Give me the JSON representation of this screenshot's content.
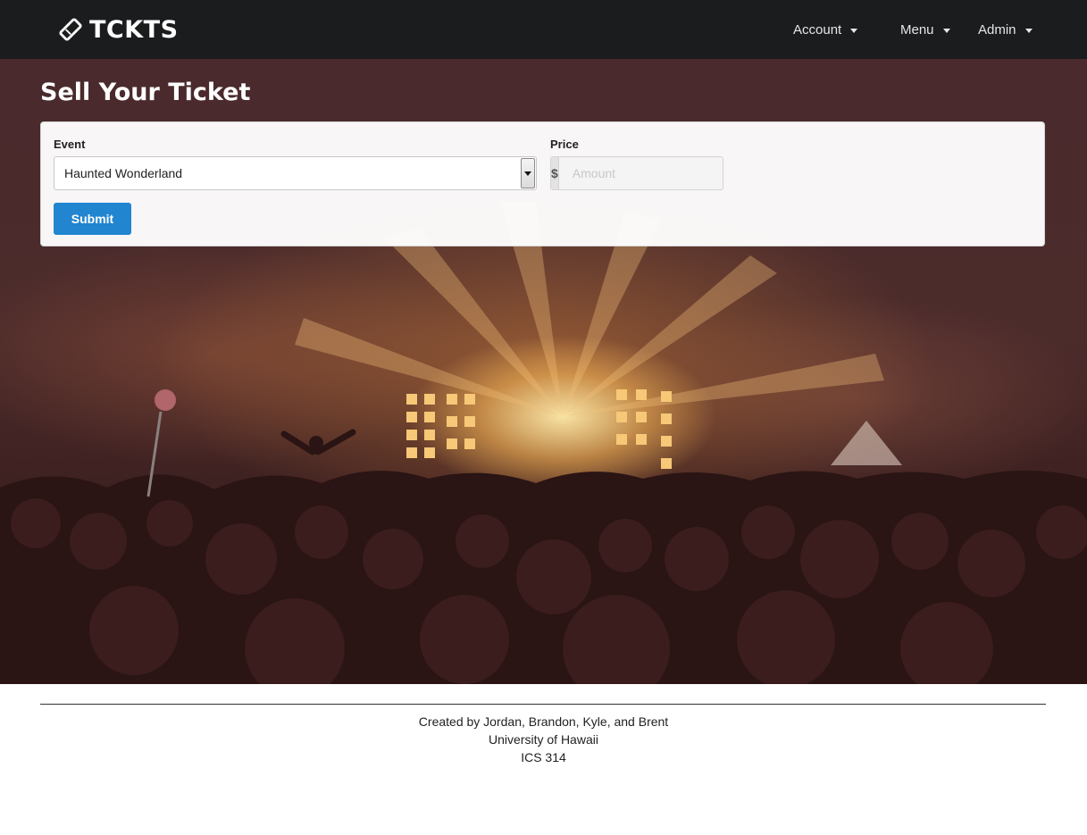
{
  "navbar": {
    "brand": "TCKTS",
    "brand_icon": "ticket-icon",
    "items": [
      {
        "label": "Account"
      },
      {
        "label": "Menu"
      },
      {
        "label": "Admin"
      }
    ]
  },
  "page": {
    "title": "Sell Your Ticket"
  },
  "form": {
    "event_label": "Event",
    "event_value": "Haunted Wonderland",
    "price_label": "Price",
    "currency_symbol": "$",
    "price_placeholder": "Amount",
    "price_value": "",
    "submit_label": "Submit"
  },
  "footer": {
    "line1": "Created by Jordan, Brandon, Kyle, and Brent",
    "line2": "University of Hawaii",
    "line3": "ICS 314"
  },
  "colors": {
    "navbar_bg": "#1b1c1d",
    "primary_button": "#2185d0"
  }
}
